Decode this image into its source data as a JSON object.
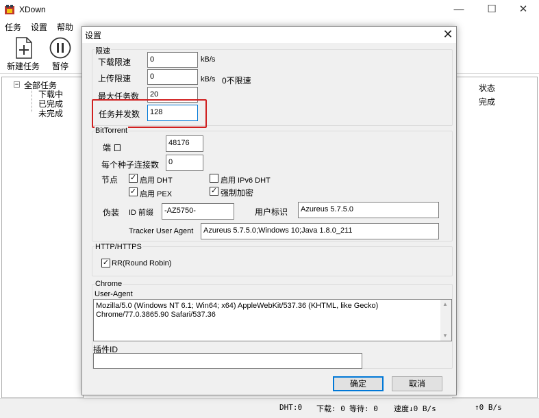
{
  "app": {
    "title": "XDown"
  },
  "window_controls": {
    "minimize": "—",
    "maximize": "☐",
    "close": "✕"
  },
  "menu": [
    "任务",
    "设置",
    "帮助"
  ],
  "toolbar": {
    "new_task": "新建任务",
    "pause": "暂停"
  },
  "tree": {
    "root": "全部任务",
    "children": [
      "下载中",
      "已完成",
      "未完成"
    ]
  },
  "task_list": {
    "col_status": "状态",
    "row_status": "完成"
  },
  "status_bar": {
    "dht": "DHT:0",
    "download": "下载: 0",
    "waiting": "等待: 0",
    "speed_down": "速度↓0 B/s",
    "speed_up": "↑0 B/s"
  },
  "dialog": {
    "title": "设置",
    "close": "✕",
    "speed_limit": {
      "group_label": "限速",
      "download_label": "下载限速",
      "download_value": "0",
      "download_unit": "kB/s",
      "upload_label": "上传限速",
      "upload_value": "0",
      "upload_unit": "kB/s",
      "no_limit_note": "0不限速",
      "max_tasks_label": "最大任务数",
      "max_tasks_value": "20",
      "concurrency_label": "任务并发数",
      "concurrency_value": "128"
    },
    "bittorrent": {
      "group_label": "BitTorrent",
      "port_label": "端 口",
      "port_value": "48176",
      "conn_label": "每个种子连接数",
      "conn_value": "0",
      "node_label": "节点",
      "dht_label": "启用 DHT",
      "dht_checked": true,
      "ipv6_label": "启用 IPv6 DHT",
      "ipv6_checked": false,
      "pex_label": "启用 PEX",
      "pex_checked": true,
      "encrypt_label": "强制加密",
      "encrypt_checked": true,
      "disguise_label": "伪装",
      "id_prefix_label": "ID 前缀",
      "id_prefix_value": "-AZ5750-",
      "user_id_label": "用户标识",
      "user_id_value": "Azureus 5.7.5.0",
      "tracker_ua_label": "Tracker User Agent",
      "tracker_ua_value": "Azureus 5.7.5.0;Windows 10;Java 1.8.0_211"
    },
    "http": {
      "group_label": "HTTP/HTTPS",
      "rr_label": "RR(Round Robin)",
      "rr_checked": true
    },
    "chrome": {
      "group_label": "Chrome",
      "ua_label": "User-Agent",
      "ua_value": "Mozilla/5.0 (Windows NT 6.1; Win64; x64) AppleWebKit/537.36 (KHTML, like Gecko) Chrome/77.0.3865.90 Safari/537.36",
      "plugin_label": "插件ID",
      "plugin_value": ""
    },
    "ok": "确定",
    "cancel": "取消"
  }
}
